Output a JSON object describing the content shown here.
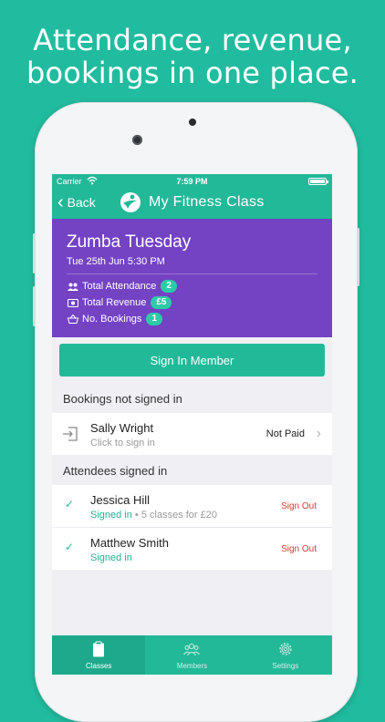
{
  "headline": {
    "line1": "Attendance, revenue,",
    "line2": "bookings in one place."
  },
  "status_bar": {
    "carrier": "Carrier",
    "time": "7:59 PM"
  },
  "nav": {
    "back_label": "Back",
    "title": "My Fitness Class"
  },
  "class_info": {
    "name": "Zumba Tuesday",
    "datetime": "Tue 25th Jun 5:30 PM",
    "stats": [
      {
        "label": "Total Attendance",
        "value": "2",
        "icon": "people-icon"
      },
      {
        "label": "Total Revenue",
        "value": "£5",
        "icon": "money-icon"
      },
      {
        "label": "No. Bookings",
        "value": "1",
        "icon": "basket-icon"
      }
    ]
  },
  "sign_in_button": "Sign In Member",
  "bookings_section": {
    "header": "Bookings not signed in",
    "items": [
      {
        "name": "Sally Wright",
        "subtitle": "Click to sign in",
        "status": "Not Paid"
      }
    ]
  },
  "attendees_section": {
    "header": "Attendees signed in",
    "items": [
      {
        "name": "Jessica Hill",
        "signed_in": "Signed in",
        "detail": " • 5 classes for £20",
        "action": "Sign Out"
      },
      {
        "name": "Matthew Smith",
        "signed_in": "Signed in",
        "detail": "",
        "action": "Sign Out"
      }
    ]
  },
  "tabs": [
    {
      "label": "Classes",
      "icon": "clipboard-icon",
      "active": true
    },
    {
      "label": "Members",
      "icon": "members-icon",
      "active": false
    },
    {
      "label": "Settings",
      "icon": "gear-icon",
      "active": false
    }
  ],
  "colors": {
    "background": "#21bc9f",
    "accent": "#22b999",
    "hero": "#7443c4",
    "danger": "#d83b2f"
  }
}
